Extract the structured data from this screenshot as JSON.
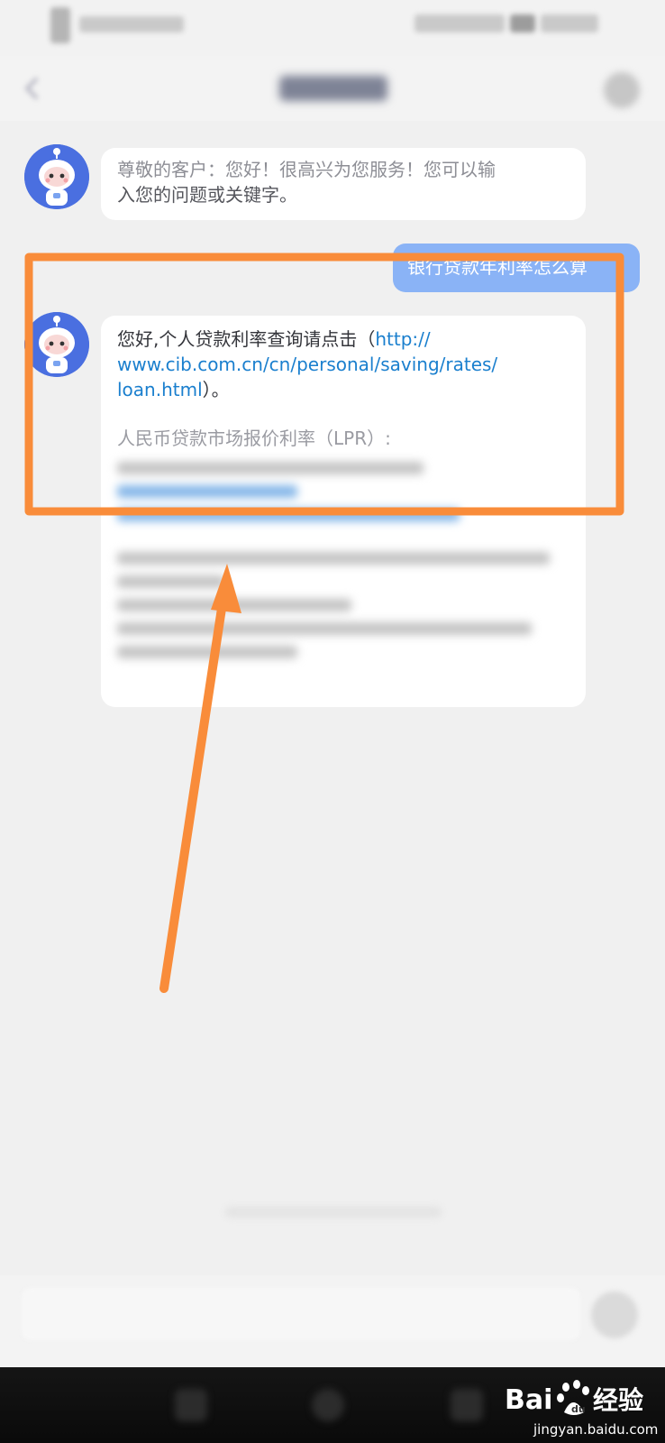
{
  "chat": {
    "welcome_message": {
      "line1": "尊敬的客户：您好！很高兴为您服务！您可以输",
      "line2": "入您的问题或关键字。"
    },
    "user_message": "银行贷款年利率怎么算",
    "bot_reply": {
      "intro": "您好,个人贷款利率查询请点击（",
      "link_part1": "http://",
      "link_part2": "www.cib.com.cn/cn/personal/saving/rates/",
      "link_part3": "loan.html",
      "after_link": "）。",
      "lpr_heading": "人民币贷款市场报价利率（LPR）:"
    }
  },
  "watermark": {
    "logo_text_left": "Bai",
    "logo_text_right": "经验",
    "url": "jingyan.baidu.com"
  },
  "colors": {
    "background": "#f0f0f0",
    "user_bubble": "#8ab3f6",
    "avatar": "#4a6fe0",
    "link": "#1a7fce",
    "annotation": "#f98c3a"
  },
  "icons": {
    "back": "back-icon",
    "menu": "menu-icon",
    "avatar": "robot-avatar-icon",
    "send": "send-icon",
    "annotation_arrow": "arrow-icon"
  }
}
